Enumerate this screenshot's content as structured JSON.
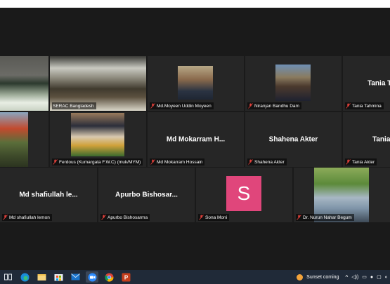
{
  "app": {
    "name": "Zoom meeting gallery view"
  },
  "colors": {
    "active_speaker_outline": "#c8e56a",
    "muted_icon": "#e0403a",
    "avatar_bg": "#e0467b",
    "tile_bg": "#262626",
    "taskbar_bg": "#202a38"
  },
  "tiles": [
    {
      "id": "r1c0",
      "label": "",
      "muted": false
    },
    {
      "id": "r1c1",
      "label": "SERAC Bangladesh",
      "muted": false,
      "active": true
    },
    {
      "id": "r1c2",
      "label": "Md.Moyeen Uddin Moyeen",
      "muted": true
    },
    {
      "id": "r1c3",
      "label": "Niranjan Bandhu Dam",
      "muted": true
    },
    {
      "id": "r1c4",
      "label": "Tania Tahmina",
      "muted": true,
      "display_name": "Tania Ta"
    },
    {
      "id": "r2c0",
      "label": "",
      "muted": false
    },
    {
      "id": "r2c1",
      "label": "Ferdous (Kumargata F.W.C) (muk/MYM)",
      "muted": true
    },
    {
      "id": "r2c2",
      "label": "Md Mokarram Hossain",
      "muted": true,
      "display_name": "Md Mokarram H..."
    },
    {
      "id": "r2c3",
      "label": "Shahena Akter",
      "muted": true,
      "display_name": "Shahena Akter"
    },
    {
      "id": "r2c4",
      "label": "Tania Akter",
      "muted": true,
      "display_name": "Tania"
    },
    {
      "id": "r3c0",
      "label": "Md shafiullah lemon",
      "muted": true,
      "display_name": "Md shafiullah le..."
    },
    {
      "id": "r3c1",
      "label": "Apurbo Bishosarma",
      "muted": true,
      "display_name": "Apurbo Bishosar..."
    },
    {
      "id": "r3c2",
      "label": "Sona Moni",
      "muted": true,
      "avatar_letter": "S"
    },
    {
      "id": "r3c3",
      "label": "Dr. Nurun Nahar Begum",
      "muted": true
    }
  ],
  "taskbar": {
    "icons": [
      "task-view-icon",
      "edge-icon",
      "file-explorer-icon",
      "store-icon",
      "mail-icon",
      "zoom-icon",
      "chrome-icon",
      "powerpoint-icon"
    ],
    "weather_text": "Sunset coming"
  }
}
